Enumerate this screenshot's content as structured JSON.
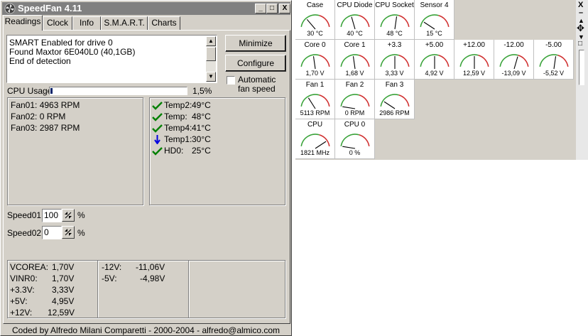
{
  "window": {
    "title": "SpeedFan 4.11",
    "controls": [
      "_",
      "□",
      "X"
    ]
  },
  "tabs": [
    "Readings",
    "Clock",
    "Info",
    "S.M.A.R.T.",
    "Charts"
  ],
  "log": {
    "lines": [
      "SMART Enabled for drive 0",
      "Found Maxtor 6E040L0 (40,1GB)",
      "End of detection"
    ]
  },
  "buttons": {
    "minimize": "Minimize",
    "configure": "Configure"
  },
  "auto_fan": {
    "line1": "Automatic",
    "line2": "fan speed",
    "checked": false
  },
  "cpu_usage": {
    "label": "CPU Usage",
    "value": "1,5%",
    "fraction": 0.015
  },
  "fans": [
    "Fan01: 4963 RPM",
    "Fan02: 0 RPM",
    "Fan03: 2987 RPM"
  ],
  "temps": [
    {
      "icon": "check-icon",
      "name": "Temp2:",
      "value": "49°C"
    },
    {
      "icon": "check-icon",
      "name": "Temp:",
      "value": "48°C"
    },
    {
      "icon": "check-icon",
      "name": "Temp4:",
      "value": "41°C"
    },
    {
      "icon": "arrow-down-icon",
      "name": "Temp1:",
      "value": "30°C"
    },
    {
      "icon": "check-icon",
      "name": "HD0:",
      "value": "25°C"
    }
  ],
  "speeds": [
    {
      "label": "Speed01:",
      "value": "100",
      "unit": "%"
    },
    {
      "label": "Speed02:",
      "value": "0",
      "unit": "%"
    }
  ],
  "voltages_left": [
    {
      "name": "VCOREA:",
      "value": "1,70V"
    },
    {
      "name": "VINR0:",
      "value": "1,70V"
    },
    {
      "name": "+3.3V:",
      "value": "3,33V"
    },
    {
      "name": "+5V:",
      "value": "4,95V"
    },
    {
      "name": "+12V:",
      "value": "12,59V"
    }
  ],
  "voltages_right": [
    {
      "name": "-12V:",
      "value": "-11,06V"
    },
    {
      "name": "-5V:",
      "value": "-4,98V"
    }
  ],
  "footer": "Coded by Alfredo Milani Comparetti - 2000-2004 - alfredo@almico.com",
  "gauges": [
    [
      {
        "label": "Case",
        "value": "30 °C",
        "level": 0.25
      },
      {
        "label": "CPU Diode",
        "value": "40 °C",
        "level": 0.4
      },
      {
        "label": "CPU Socket",
        "value": "48 °C",
        "level": 0.55
      },
      {
        "label": "Sensor 4",
        "value": "15 °C",
        "level": 0.15
      }
    ],
    [
      {
        "label": "Core 0",
        "value": "1,70 V",
        "level": 0.45
      },
      {
        "label": "Core 1",
        "value": "1,68 V",
        "level": 0.45
      },
      {
        "label": "+3.3",
        "value": "3,33 V",
        "level": 0.5
      },
      {
        "label": "+5.00",
        "value": "4,92 V",
        "level": 0.5
      },
      {
        "label": "+12.00",
        "value": "12,59 V",
        "level": 0.5
      },
      {
        "label": "-12.00",
        "value": "-13,09 V",
        "level": 0.6
      },
      {
        "label": "-5.00",
        "value": "-5,52 V",
        "level": 0.55
      }
    ],
    [
      {
        "label": "Fan 1",
        "value": "5113 RPM",
        "level": 0.3
      },
      {
        "label": "Fan 2",
        "value": "0 RPM",
        "level": 0.0
      },
      {
        "label": "Fan 3",
        "value": "2986 RPM",
        "level": 0.15
      }
    ],
    [
      {
        "label": "CPU",
        "value": "1821 MHz",
        "level": 0.85
      },
      {
        "label": "CPU 0",
        "value": "0 %",
        "level": 0.0
      }
    ]
  ],
  "side_strip": [
    "X",
    "–",
    "▲",
    "✥",
    "▼",
    "□"
  ]
}
